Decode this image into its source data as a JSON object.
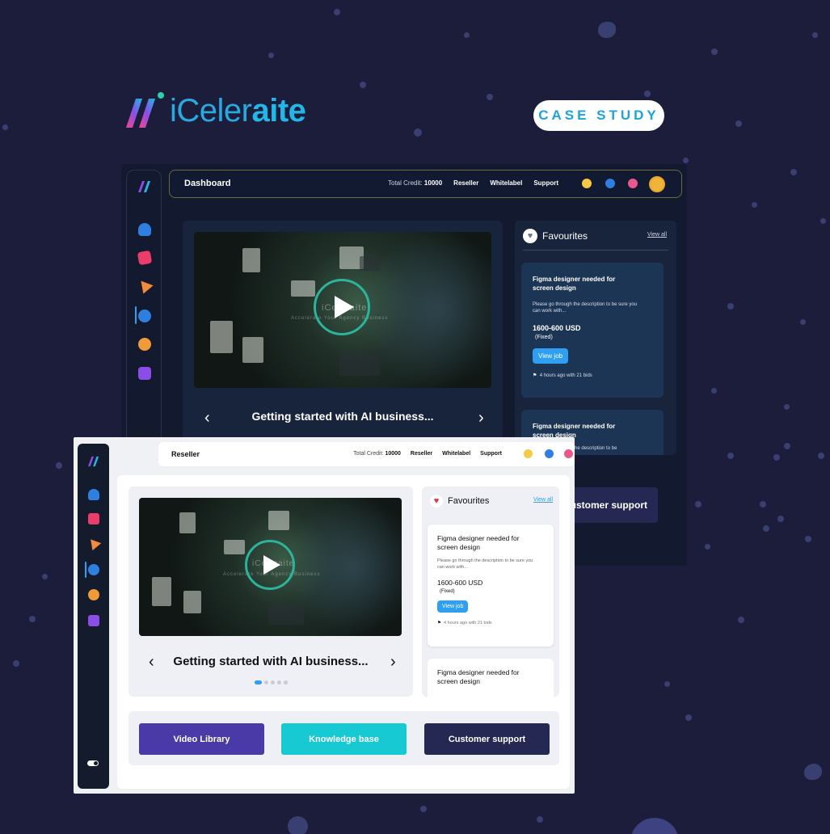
{
  "brand": {
    "prefix": "iCeler",
    "suffix": "aite",
    "tag": "CASE STUDY"
  },
  "dark": {
    "title": "Dashboard",
    "credit_label": "Total Credit:",
    "credit_value": "10000",
    "nav": [
      "Reseller",
      "Whitelabel",
      "Support"
    ],
    "video_title": "Getting started with AI business...",
    "watermark": "iCeleraite",
    "watermark_sub": "Accelerate Your Agency Business",
    "favourites": {
      "title": "Favourites",
      "view_all": "View all",
      "jobs": [
        {
          "title": "Figma designer needed for screen design",
          "desc": "Please go through the description to be sure you can work with...",
          "price": "1600-600 USD",
          "type": "(Fixed)",
          "button": "View job",
          "meta": "4 hours ago with 21 bids"
        },
        {
          "title": "Figma designer needed for screen design",
          "desc": "Please go through the description to be"
        }
      ]
    },
    "customer_support": "Customer support",
    "icons": [
      "app-logo-icon",
      "cloud-icon",
      "analytics-icon",
      "send-icon",
      "user-chat-icon",
      "coin-icon",
      "crown-icon",
      "bulb-icon",
      "chat-bubble-icon",
      "flower-icon"
    ]
  },
  "light": {
    "title": "Reseller",
    "credit_label": "Total Credit:",
    "credit_value": "10000",
    "nav": [
      "Reseller",
      "Whitelabel",
      "Support"
    ],
    "video_title": "Getting started with AI business...",
    "carousel_count": 5,
    "carousel_active": 0,
    "favourites": {
      "title": "Favourites",
      "view_all": "View all",
      "jobs": [
        {
          "title": "Figma designer needed for screen design",
          "desc": "Please go through the description to be sure you can work with...",
          "price": "1600-600 USD",
          "type": "(Fixed)",
          "button": "View job",
          "meta": "4 hours ago with 21 bids"
        },
        {
          "title": "Figma designer needed for screen design"
        }
      ]
    },
    "buttons": [
      {
        "label": "Video Library",
        "color": "#4a3aa8"
      },
      {
        "label": "Knowledge base",
        "color": "#17c9d2"
      },
      {
        "label": "Customer support",
        "color": "#242853"
      }
    ]
  },
  "colors": {
    "background": "#1c1d3a",
    "accent": "#2e9ff2",
    "brand": "#22b7e6"
  }
}
